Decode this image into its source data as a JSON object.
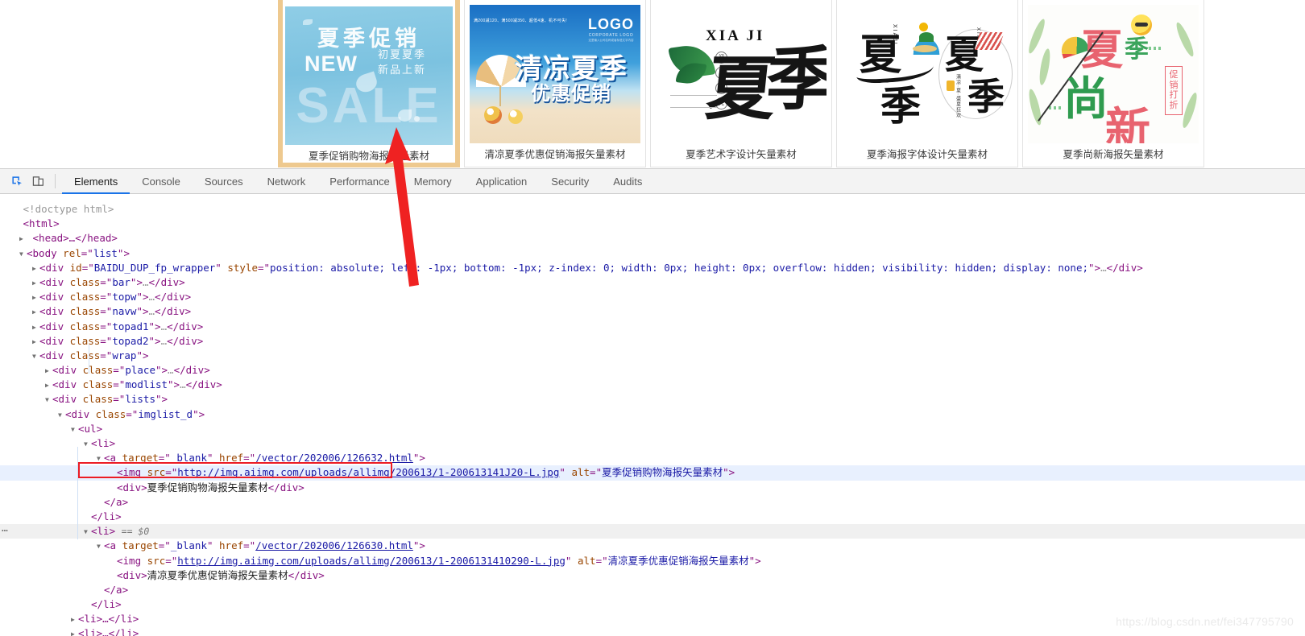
{
  "page": {
    "watermark": "https://blog.csdn.net/fei347795790"
  },
  "gallery": {
    "items": [
      {
        "caption": "夏季促销购物海报矢量素材",
        "hovered": true,
        "poster": {
          "title_zh": "夏季促销",
          "new_label": "NEW",
          "sub_line1": "初夏夏季",
          "sub_line2": "新品上新",
          "sale_label": "SALE"
        }
      },
      {
        "caption": "清凉夏季优惠促销海报矢量素材",
        "hovered": false,
        "poster": {
          "tiny_text": "满200减120、满500减350、超低4速、机不可失!",
          "logo_label": "LOGO",
          "logo_sub": "CORPORATE  LOGO",
          "logo_sub2": "这里输入公司名称或者标语文字内容",
          "title_zh": "清凉夏季",
          "subtitle_zh": "优惠促销"
        }
      },
      {
        "caption": "夏季艺术字设计矢量素材",
        "hovered": false,
        "poster": {
          "pinyin": "XIA JI",
          "char1": "夏",
          "char2": "季",
          "stamps": [
            "初",
            "夏",
            "时",
            "光"
          ]
        }
      },
      {
        "caption": "夏季海报字体设计矢量素材",
        "hovered": false,
        "poster": {
          "left_char1": "夏",
          "left_char2": "季",
          "left_pinyin": "XIAJI",
          "right_char1": "夏",
          "right_char2": "季",
          "right_pinyin": "XIAJI",
          "right_note": "清凉·夏·盛夏狂欢"
        }
      },
      {
        "caption": "夏季尚新海报矢量素材",
        "hovered": false,
        "poster": {
          "char_xia": "夏",
          "char_ji": "季",
          "char_shang": "尚",
          "char_xin": "新",
          "badge": "促销打折"
        }
      }
    ]
  },
  "devtools": {
    "toolbar": {
      "inspect_icon": "inspect-element-icon",
      "device_icon": "device-toolbar-icon",
      "tabs": [
        {
          "label": "Elements",
          "active": true
        },
        {
          "label": "Console",
          "active": false
        },
        {
          "label": "Sources",
          "active": false
        },
        {
          "label": "Network",
          "active": false
        },
        {
          "label": "Performance",
          "active": false
        },
        {
          "label": "Memory",
          "active": false
        },
        {
          "label": "Application",
          "active": false
        },
        {
          "label": "Security",
          "active": false
        },
        {
          "label": "Audits",
          "active": false
        }
      ]
    },
    "dom": {
      "doctype": "<!doctype html>",
      "html_open": "<html>",
      "head_collapsed": "<head>…</head>",
      "body_open_tag": "body",
      "body_attr_name": "rel",
      "body_attr_value": "list",
      "baidu_div_tag": "div",
      "baidu_attr1_name": "id",
      "baidu_attr1_value": "BAIDU_DUP_fp_wrapper",
      "baidu_attr2_name": "style",
      "baidu_attr2_value": "position: absolute; left: -1px; bottom: -1px; z-index: 0; width: 0px; height: 0px; overflow: hidden; visibility: hidden; display: none;",
      "collapsed_divs": [
        "bar",
        "topw",
        "navw",
        "topad1",
        "topad2"
      ],
      "wrap_class": "wrap",
      "place_class": "place",
      "modlist_class": "modlist",
      "lists_class": "lists",
      "imglist_class": "imglist_d",
      "ul_tag": "<ul>",
      "item1": {
        "li_open": "<li>",
        "a_target_name": "target",
        "a_target_value": "_blank",
        "a_href_name": "href",
        "a_href_value": "/vector/202006/126632.html",
        "img_src_name": "src",
        "img_src_value": "http://img.aiimg.com/uploads/allimg/200613/1-200613141J20-L.jpg",
        "img_alt_name": "alt",
        "img_alt_value": "夏季促销购物海报矢量素材",
        "div_text": "夏季促销购物海报矢量素材",
        "a_close": "</a>",
        "li_close": "</li>"
      },
      "item2": {
        "li_open": "<li>",
        "selected_marker": "== $0",
        "a_target_name": "target",
        "a_target_value": "_blank",
        "a_href_name": "href",
        "a_href_value": "/vector/202006/126630.html",
        "img_src_name": "src",
        "img_src_value": "http://img.aiimg.com/uploads/allimg/200613/1-2006131410290-L.jpg",
        "img_alt_name": "alt",
        "img_alt_value": "清凉夏季优惠促销海报矢量素材",
        "div_text": "清凉夏季优惠促销海报矢量素材",
        "a_close": "</a>",
        "li_close": "</li>"
      },
      "collapsed_li": "<li>…</li>",
      "left_ellipsis": "…"
    }
  }
}
